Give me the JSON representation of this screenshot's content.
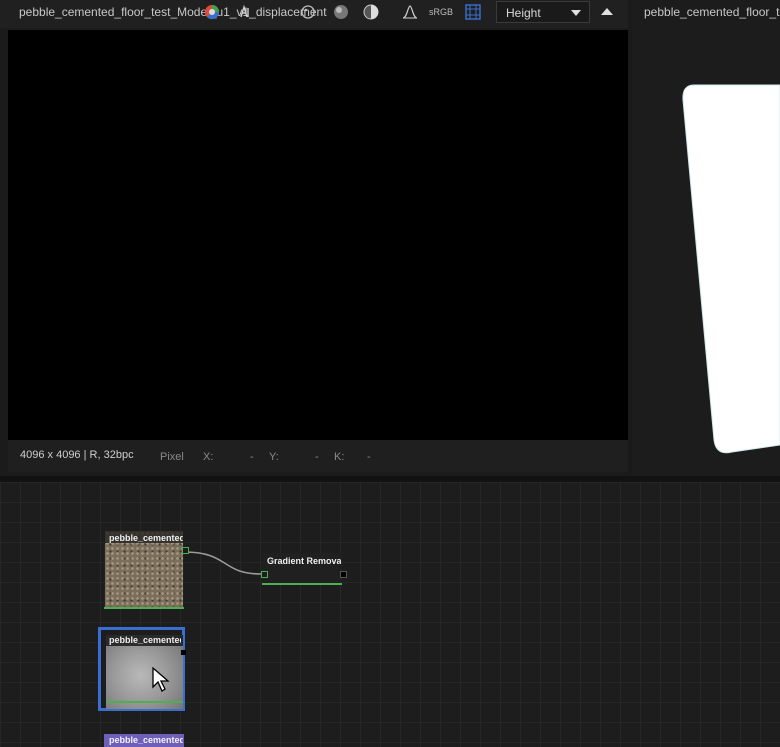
{
  "view2d": {
    "title": "pebble_cemented_floor_test_Model_u1_v1_displacement",
    "color_space": "sRGB",
    "channel": "Height",
    "status": {
      "resolution": "4096 x 4096",
      "separator": "|",
      "format": "R, 32bpc",
      "pixel_label": "Pixel",
      "x_label": "X:",
      "x_value": "-",
      "y_label": "Y:",
      "y_value": "-",
      "k_label": "K:",
      "k_value": "-"
    }
  },
  "view3d": {
    "title": "pebble_cemented_floor_te"
  },
  "graph": {
    "nodes": [
      {
        "title": "pebble_cemented"
      },
      {
        "title": "Gradient Remova"
      },
      {
        "title": "pebble_cemented"
      },
      {
        "title": "pebble_cemented"
      }
    ]
  },
  "icons": [
    "color-wheel-icon",
    "alpha-icon",
    "palette-icon",
    "sphere-shaded-icon",
    "half-circle-icon",
    "histogram-icon",
    "grid-frame-icon",
    "dropdown-caret-icon",
    "collapse-up-icon",
    "mouse-cursor-icon"
  ],
  "colors": {
    "selection": "#3a6fd1",
    "node_output": "#4caf50",
    "accent_purple": "#6f5fb8"
  }
}
